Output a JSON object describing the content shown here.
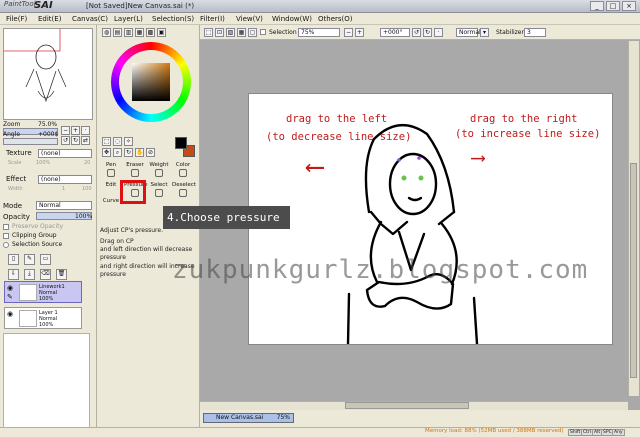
{
  "window": {
    "logo_top": "PaintTool",
    "logo_main": "SAI",
    "title": "[Not Saved]New Canvas.sai (*)",
    "controls": [
      "_",
      "□",
      "×"
    ]
  },
  "menu": [
    "File(F)",
    "Edit(E)",
    "Canvas(C)",
    "Layer(L)",
    "Selection(S)",
    "Filter(I)",
    "View(V)",
    "Window(W)",
    "Others(O)"
  ],
  "navigator": {
    "zoom_label": "Zoom",
    "zoom_value": "75.0%",
    "angle_label": "Angle",
    "angle_value": "+000$"
  },
  "texture": {
    "label": "Texture",
    "value": "(none)",
    "scale_label": "Scale",
    "scale_value": "100%",
    "scale_num": "20"
  },
  "effect": {
    "label": "Effect",
    "value": "(none)",
    "width_label": "Width",
    "width_num": "1",
    "width_value": "100"
  },
  "mode": {
    "label": "Mode",
    "value": "Normal"
  },
  "opacity": {
    "label": "Opacity",
    "value": "100%"
  },
  "checks": [
    "Preserve Opacity",
    "Clipping Group",
    "Selection Source"
  ],
  "layers": [
    {
      "name": "Linework1",
      "mode": "Normal",
      "opacity": "100%",
      "selected": true
    },
    {
      "name": "Layer 1",
      "mode": "Normal",
      "opacity": "100%",
      "selected": false
    }
  ],
  "tools": {
    "row1": [
      "Pen",
      "Eraser",
      "Weight",
      "Color"
    ],
    "row2": [
      "Edit",
      "Pressure",
      "Select",
      "Deselect"
    ],
    "row3": [
      "Curve"
    ]
  },
  "tool_desc": [
    "Adjust CP's pressure.",
    "Drag on CP",
    "and left direction will decrease",
    "pressure",
    "and right direction will increase",
    "pressure"
  ],
  "canvas_toolbar": {
    "selection_label": "Selection",
    "zoom": "75%",
    "angle": "+000°",
    "blend": "Normal",
    "stabilizer_label": "Stabilizer",
    "stabilizer_value": "3"
  },
  "annotations": {
    "left_line1": "drag to the left",
    "left_line2": "(to decrease line size)",
    "left_arrow": "⟵",
    "right_line1": "drag to the right",
    "right_line2": "(to increase line size)",
    "right_arrow": "⟶",
    "step": "4.Choose pressure",
    "watermark": "zukpunkgurlz.blogspot.com"
  },
  "doc_tab": {
    "name": "New Canvas.sai",
    "zoom": "75%"
  },
  "status": {
    "memory": "Memory load: 88% (52MB used / 388MB reserved)",
    "indicators": [
      "Shift",
      "Ctrl",
      "Alt",
      "SPC",
      "Any"
    ]
  }
}
